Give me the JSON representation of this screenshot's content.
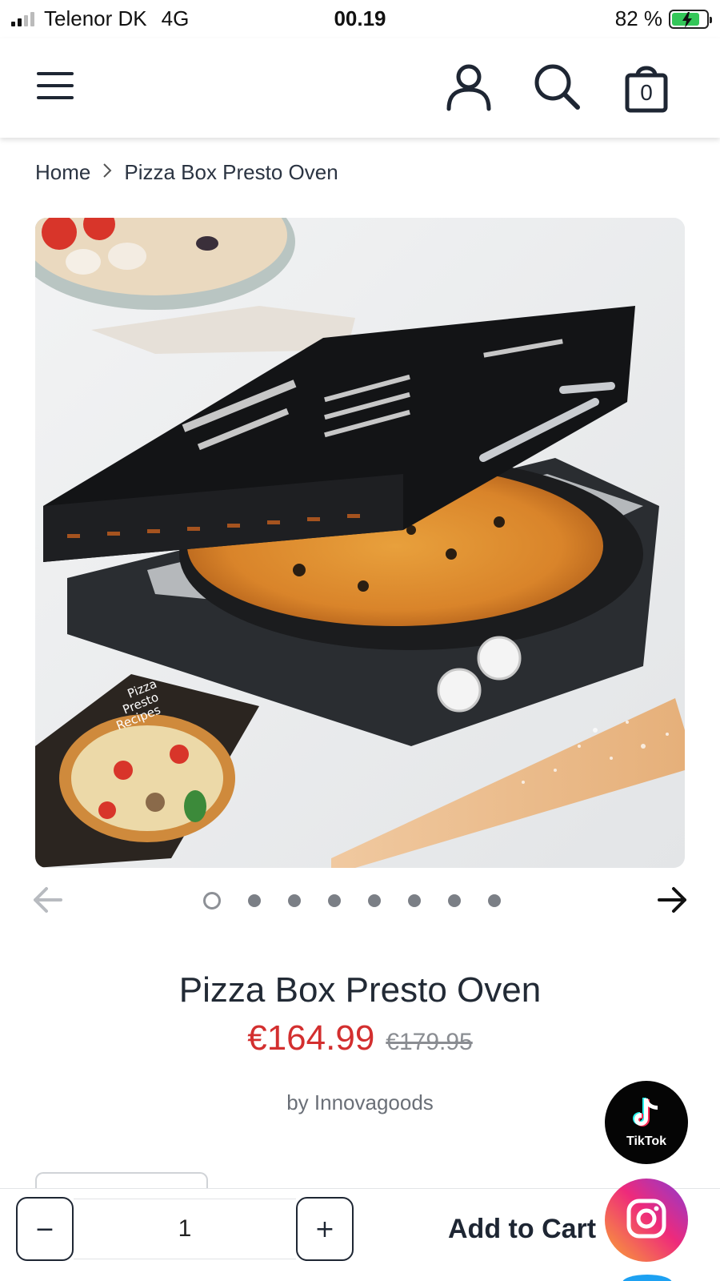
{
  "status_bar": {
    "carrier": "Telenor DK",
    "network": "4G",
    "time": "00.19",
    "battery": "82 %"
  },
  "header": {
    "menu_icon": "hamburger-menu-icon",
    "account_icon": "account-icon",
    "search_icon": "search-icon",
    "cart_icon": "shopping-bag-icon",
    "cart_count": "0"
  },
  "breadcrumb": {
    "home": "Home",
    "current": "Pizza Box Presto Oven"
  },
  "carousel": {
    "slide_count": 8,
    "active_index": 0
  },
  "product": {
    "title": "Pizza Box Presto Oven",
    "price": "€164.99",
    "compare_price": "€179.95",
    "vendor": "by Innovagoods"
  },
  "social": {
    "tiktok_label": "TikTok"
  },
  "cart_bar": {
    "minus_label": "−",
    "plus_label": "+",
    "quantity": "1",
    "add_to_cart_label": "Add to Cart"
  },
  "colors": {
    "sale_price": "#d32f2f",
    "text_dark": "#222a35",
    "battery": "#34c759"
  }
}
